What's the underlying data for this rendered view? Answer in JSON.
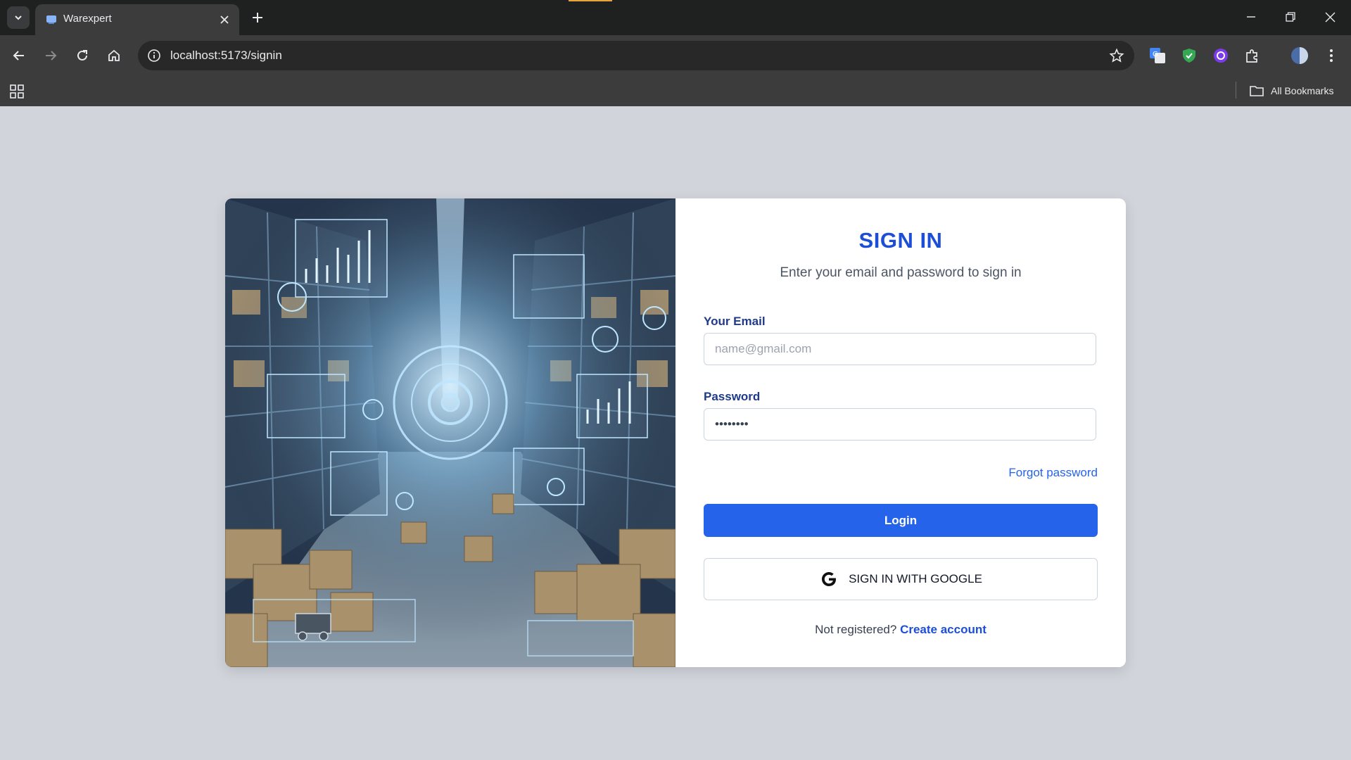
{
  "browser": {
    "tab_title": "Warexpert",
    "url": "localhost:5173/signin",
    "bookmarks_label": "All Bookmarks",
    "extensions": [
      "translate-icon",
      "shield-extension-icon",
      "tailwind-extension-icon",
      "puzzle-icon"
    ],
    "accent_loading": "#e8a33d"
  },
  "signin": {
    "title": "SIGN IN",
    "subtitle": "Enter your email and password to sign in",
    "email_label": "Your Email",
    "email_placeholder": "name@gmail.com",
    "password_label": "Password",
    "password_value": "••••••••",
    "forgot_label": "Forgot password",
    "login_label": "Login",
    "google_label": "SIGN IN WITH GOOGLE",
    "register_text": "Not registered?",
    "register_link": "Create account"
  },
  "colors": {
    "primary": "#2563eb",
    "title": "#1d4ed8",
    "label": "#1e3a8a",
    "page_bg": "#d1d5db"
  },
  "hero_image": "warehouse-illustration"
}
